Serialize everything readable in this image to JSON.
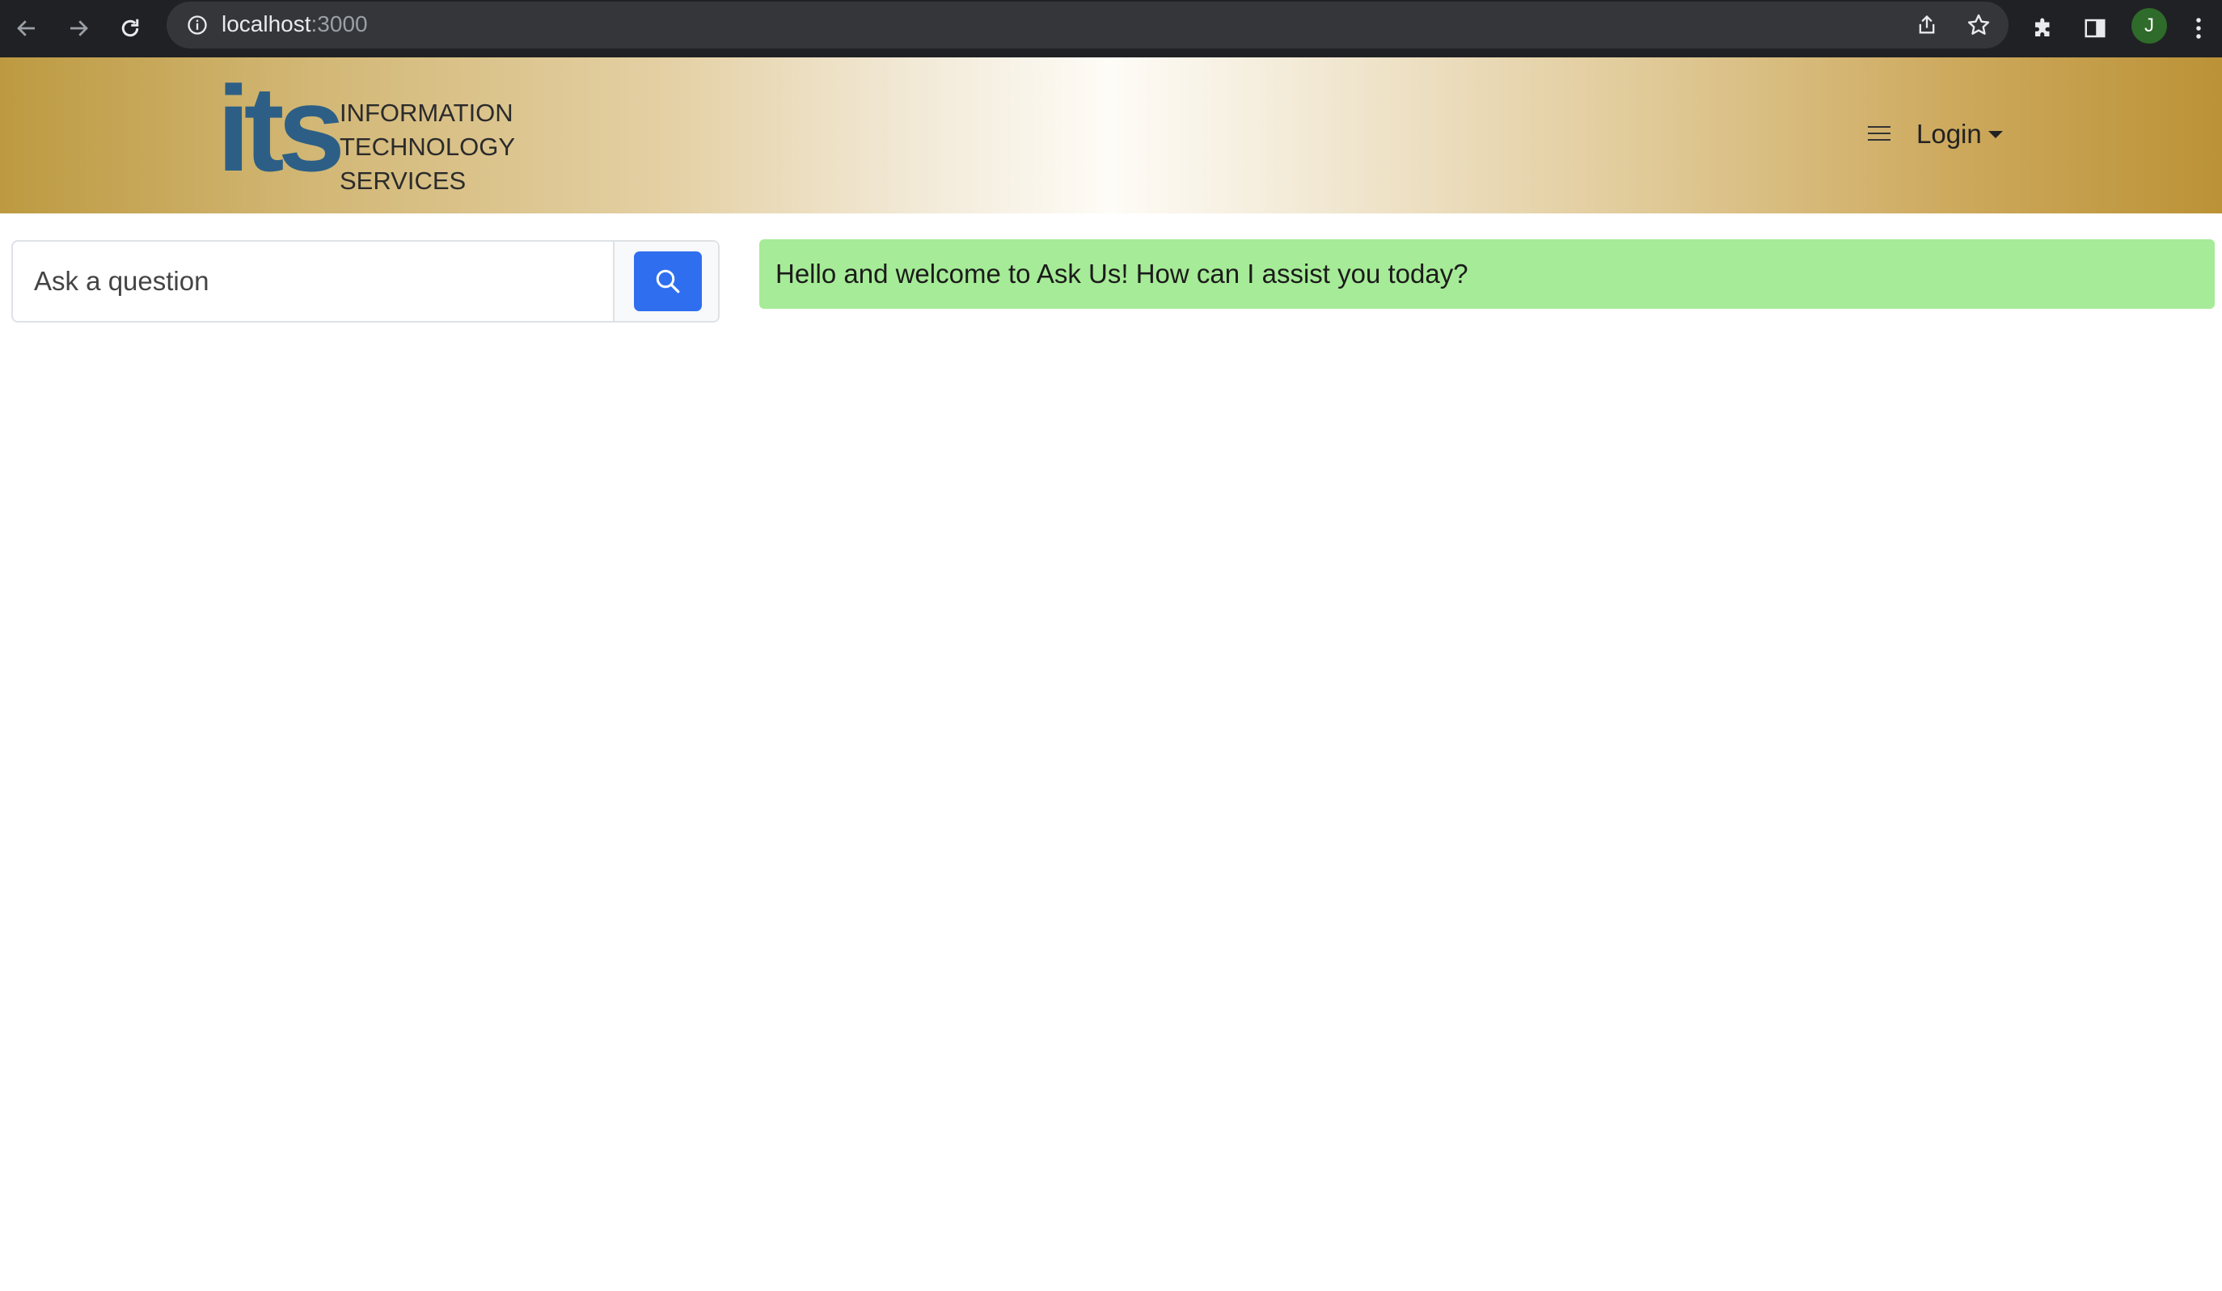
{
  "browser": {
    "url_host": "localhost",
    "url_port": ":3000",
    "avatar_initial": "J"
  },
  "header": {
    "logo": {
      "mark": "its",
      "lines": [
        "INFORMATION",
        "TECHNOLOGY",
        "SERVICES"
      ]
    },
    "login_label": "Login"
  },
  "search": {
    "placeholder": "Ask a question",
    "value": ""
  },
  "welcome_message": "Hello and welcome to Ask Us! How can I assist you today?",
  "colors": {
    "brand_blue": "#2d5f86",
    "search_button": "#2f6fef",
    "welcome_bg": "#a6eb97",
    "chrome_bg": "#202124"
  }
}
